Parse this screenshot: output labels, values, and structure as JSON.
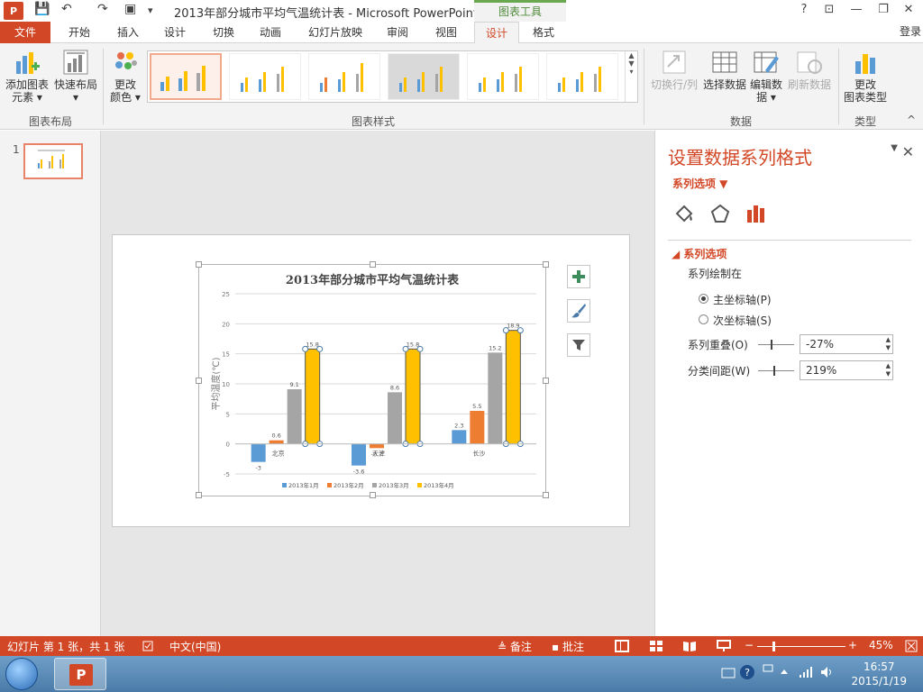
{
  "window": {
    "title": "2013年部分城市平均气温统计表 - Microsoft PowerPoint",
    "app_icon": "P",
    "chart_tools": "图表工具",
    "help": "?",
    "restore_ribbon": "⊡",
    "minimize": "—",
    "maximize": "❐",
    "close": "✕",
    "signin": "登录"
  },
  "qat": {
    "save": "💾",
    "undo": "↶",
    "redo": "↷",
    "present": "▣",
    "more": "▾"
  },
  "tabs": [
    "文件",
    "开始",
    "插入",
    "设计",
    "切换",
    "动画",
    "幻灯片放映",
    "审阅",
    "视图",
    "设计",
    "格式"
  ],
  "ribbon": {
    "add_element": "添加图表",
    "add_element2": "元素 ▾",
    "quick_layout": "快速布局",
    "quick_layout2": "▾",
    "group_layout": "图表布局",
    "change_color": "更改",
    "change_color2": "颜色 ▾",
    "group_styles": "图表样式",
    "switch_rowcol": "切换行/列",
    "select_data": "选择数据",
    "edit_data": "编辑数",
    "edit_data2": "据 ▾",
    "refresh_data": "刷新数据",
    "group_data": "数据",
    "change_type": "更改",
    "change_type2": "图表类型",
    "group_type": "类型",
    "collapse": "^"
  },
  "thumbs": {
    "number": "1"
  },
  "chart_data": {
    "type": "bar",
    "title": "2013年部分城市平均气温统计表",
    "ylabel": "平均温度(℃)",
    "xlabel": "",
    "categories": [
      "北京",
      "天津",
      "长沙"
    ],
    "series": [
      {
        "name": "2013年1月",
        "values": [
          -3,
          -3.6,
          2.3
        ],
        "color": "#5b9bd5"
      },
      {
        "name": "2013年2月",
        "values": [
          0.6,
          -0.7,
          5.5
        ],
        "color": "#ed7d31"
      },
      {
        "name": "2013年3月",
        "values": [
          9.1,
          8.6,
          15.2
        ],
        "color": "#a5a5a5"
      },
      {
        "name": "2013年4月",
        "values": [
          15.8,
          15.8,
          18.9
        ],
        "color": "#ffc000"
      }
    ],
    "value_labels": [
      [
        "-3",
        "-3.6",
        "2.3"
      ],
      [
        "0.6",
        "-0.7",
        "5.5"
      ],
      [
        "9.1",
        "8.6",
        "15.2"
      ],
      [
        "15.8",
        "15.8",
        "18.9"
      ]
    ],
    "ylim": [
      -5,
      25
    ],
    "yticks": [
      "-5",
      "0",
      "5",
      "10",
      "15",
      "20",
      "25"
    ],
    "ytick_values": [
      -5,
      0,
      5,
      10,
      15,
      20,
      25
    ],
    "grid": true,
    "legend": "bottom",
    "selected_series": "2013年4月"
  },
  "format_pane": {
    "title": "设置数据系列格式",
    "close": "✕",
    "menu": "▼",
    "series_options_dropdown": "系列选项 ▼",
    "section": "◢  系列选项",
    "plot_on": "系列绘制在",
    "primary_axis": "主坐标轴(P)",
    "secondary_axis": "次坐标轴(S)",
    "overlap_label": "系列重叠(O)",
    "overlap_value": "-27%",
    "overlap_level": -27,
    "gap_label": "分类间距(W)",
    "gap_value": "219%",
    "gap_level": 219
  },
  "status": {
    "slide_info": "幻灯片 第 1 张，共 1 张",
    "language": "中文(中国)",
    "notes": "≜ 备注",
    "comments": "▪ 批注",
    "zoom_minus": "−",
    "zoom_plus": "+",
    "zoom": "45%",
    "zoom_level": 0.45
  },
  "taskbar": {
    "ppt": "P",
    "time": "16:57",
    "date": "2015/1/19"
  }
}
